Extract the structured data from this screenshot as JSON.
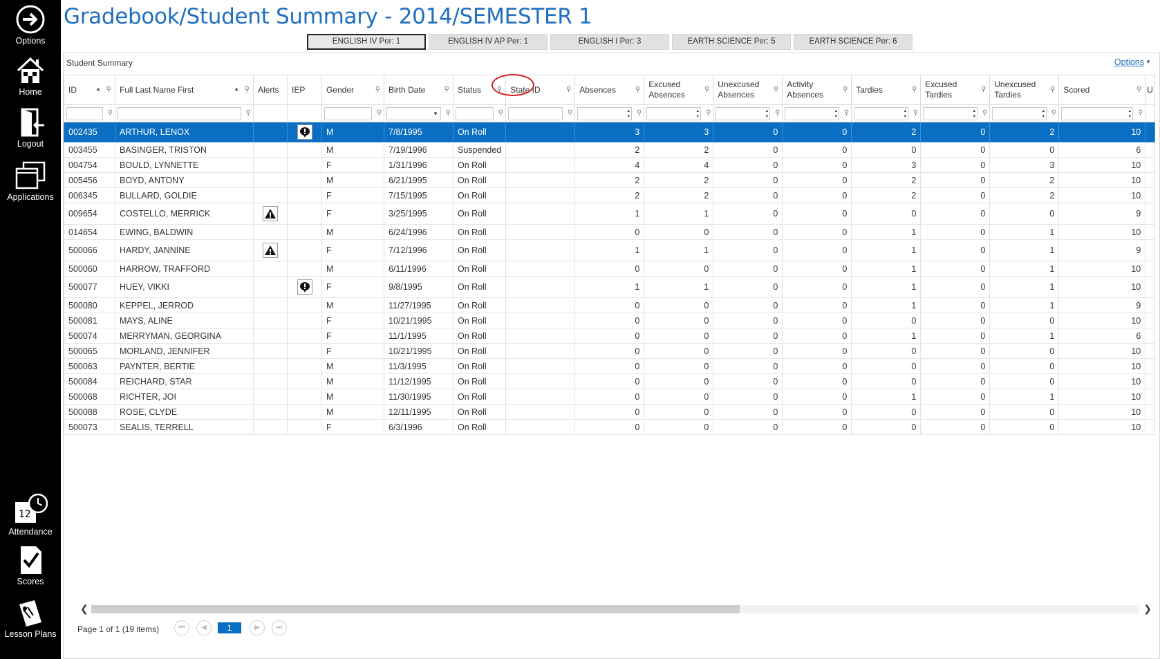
{
  "sidebar": {
    "options": "Options",
    "home": "Home",
    "logout": "Logout",
    "applications": "Applications",
    "attendance": "Attendance",
    "scores": "Scores",
    "lesson_plans": "Lesson Plans"
  },
  "header": {
    "title": "Gradebook/Student Summary - 2014/SEMESTER 1"
  },
  "tabs": [
    {
      "label": "ENGLISH IV Per: 1",
      "active": true
    },
    {
      "label": "ENGLISH IV AP Per: 1",
      "active": false
    },
    {
      "label": "ENGLISH I Per: 3",
      "active": false
    },
    {
      "label": "EARTH SCIENCE Per: 5",
      "active": false
    },
    {
      "label": "EARTH SCIENCE Per: 6",
      "active": false
    }
  ],
  "panel": {
    "title": "Student Summary",
    "options_label": "Options"
  },
  "columns": {
    "id": "ID",
    "name": "Full Last Name First",
    "alerts": "Alerts",
    "iep": "IEP",
    "gender": "Gender",
    "birth": "Birth Date",
    "status": "Status",
    "state_id": "State ID",
    "absences": "Absences",
    "exc_abs_1": "Excused",
    "exc_abs_2": "Absences",
    "unexc_abs_1": "Unexcused",
    "unexc_abs_2": "Absences",
    "act_abs_1": "Activity",
    "act_abs_2": "Absences",
    "tardies": "Tardies",
    "exc_tard_1": "Excused",
    "exc_tard_2": "Tardies",
    "unexc_tard_1": "Unexcused",
    "unexc_tard_2": "Tardies",
    "scored": "Scored",
    "next_partial": "U"
  },
  "rows": [
    {
      "id": "002435",
      "name": "ARTHUR, LENOX",
      "alert": false,
      "iep": true,
      "gender": "M",
      "birth": "7/8/1995",
      "status": "On Roll",
      "state_id": "",
      "absences": "3",
      "exc_abs": "3",
      "unexc_abs": "0",
      "act_abs": "0",
      "tardies": "2",
      "exc_tard": "0",
      "unexc_tard": "2",
      "scored": "10"
    },
    {
      "id": "003455",
      "name": "BASINGER, TRISTON",
      "alert": false,
      "iep": false,
      "gender": "M",
      "birth": "7/19/1996",
      "status": "Suspended",
      "state_id": "",
      "absences": "2",
      "exc_abs": "2",
      "unexc_abs": "0",
      "act_abs": "0",
      "tardies": "0",
      "exc_tard": "0",
      "unexc_tard": "0",
      "scored": "6"
    },
    {
      "id": "004754",
      "name": "BOULD, LYNNETTE",
      "alert": false,
      "iep": false,
      "gender": "F",
      "birth": "1/31/1996",
      "status": "On Roll",
      "state_id": "",
      "absences": "4",
      "exc_abs": "4",
      "unexc_abs": "0",
      "act_abs": "0",
      "tardies": "3",
      "exc_tard": "0",
      "unexc_tard": "3",
      "scored": "10"
    },
    {
      "id": "005456",
      "name": "BOYD, ANTONY",
      "alert": false,
      "iep": false,
      "gender": "M",
      "birth": "6/21/1995",
      "status": "On Roll",
      "state_id": "",
      "absences": "2",
      "exc_abs": "2",
      "unexc_abs": "0",
      "act_abs": "0",
      "tardies": "2",
      "exc_tard": "0",
      "unexc_tard": "2",
      "scored": "10"
    },
    {
      "id": "006345",
      "name": "BULLARD, GOLDIE",
      "alert": false,
      "iep": false,
      "gender": "F",
      "birth": "7/15/1995",
      "status": "On Roll",
      "state_id": "",
      "absences": "2",
      "exc_abs": "2",
      "unexc_abs": "0",
      "act_abs": "0",
      "tardies": "2",
      "exc_tard": "0",
      "unexc_tard": "2",
      "scored": "10"
    },
    {
      "id": "009654",
      "name": "COSTELLO, MERRICK",
      "alert": true,
      "iep": false,
      "gender": "F",
      "birth": "3/25/1995",
      "status": "On Roll",
      "state_id": "",
      "absences": "1",
      "exc_abs": "1",
      "unexc_abs": "0",
      "act_abs": "0",
      "tardies": "0",
      "exc_tard": "0",
      "unexc_tard": "0",
      "scored": "9"
    },
    {
      "id": "014654",
      "name": "EWING, BALDWIN",
      "alert": false,
      "iep": false,
      "gender": "M",
      "birth": "6/24/1996",
      "status": "On Roll",
      "state_id": "",
      "absences": "0",
      "exc_abs": "0",
      "unexc_abs": "0",
      "act_abs": "0",
      "tardies": "1",
      "exc_tard": "0",
      "unexc_tard": "1",
      "scored": "10"
    },
    {
      "id": "500066",
      "name": "HARDY, JANNINE",
      "alert": true,
      "iep": false,
      "gender": "F",
      "birth": "7/12/1996",
      "status": "On Roll",
      "state_id": "",
      "absences": "1",
      "exc_abs": "1",
      "unexc_abs": "0",
      "act_abs": "0",
      "tardies": "1",
      "exc_tard": "0",
      "unexc_tard": "1",
      "scored": "9"
    },
    {
      "id": "500060",
      "name": "HARROW, TRAFFORD",
      "alert": false,
      "iep": false,
      "gender": "M",
      "birth": "6/11/1996",
      "status": "On Roll",
      "state_id": "",
      "absences": "0",
      "exc_abs": "0",
      "unexc_abs": "0",
      "act_abs": "0",
      "tardies": "1",
      "exc_tard": "0",
      "unexc_tard": "1",
      "scored": "10"
    },
    {
      "id": "500077",
      "name": "HUEY, VIKKI",
      "alert": false,
      "iep": true,
      "gender": "F",
      "birth": "9/8/1995",
      "status": "On Roll",
      "state_id": "",
      "absences": "1",
      "exc_abs": "1",
      "unexc_abs": "0",
      "act_abs": "0",
      "tardies": "1",
      "exc_tard": "0",
      "unexc_tard": "1",
      "scored": "10"
    },
    {
      "id": "500080",
      "name": "KEPPEL, JERROD",
      "alert": false,
      "iep": false,
      "gender": "M",
      "birth": "11/27/1995",
      "status": "On Roll",
      "state_id": "",
      "absences": "0",
      "exc_abs": "0",
      "unexc_abs": "0",
      "act_abs": "0",
      "tardies": "1",
      "exc_tard": "0",
      "unexc_tard": "1",
      "scored": "9"
    },
    {
      "id": "500081",
      "name": "MAYS, ALINE",
      "alert": false,
      "iep": false,
      "gender": "F",
      "birth": "10/21/1995",
      "status": "On Roll",
      "state_id": "",
      "absences": "0",
      "exc_abs": "0",
      "unexc_abs": "0",
      "act_abs": "0",
      "tardies": "0",
      "exc_tard": "0",
      "unexc_tard": "0",
      "scored": "10"
    },
    {
      "id": "500074",
      "name": "MERRYMAN, GEORGINA",
      "alert": false,
      "iep": false,
      "gender": "F",
      "birth": "11/1/1995",
      "status": "On Roll",
      "state_id": "",
      "absences": "0",
      "exc_abs": "0",
      "unexc_abs": "0",
      "act_abs": "0",
      "tardies": "1",
      "exc_tard": "0",
      "unexc_tard": "1",
      "scored": "6"
    },
    {
      "id": "500065",
      "name": "MORLAND, JENNIFER",
      "alert": false,
      "iep": false,
      "gender": "F",
      "birth": "10/21/1995",
      "status": "On Roll",
      "state_id": "",
      "absences": "0",
      "exc_abs": "0",
      "unexc_abs": "0",
      "act_abs": "0",
      "tardies": "0",
      "exc_tard": "0",
      "unexc_tard": "0",
      "scored": "10"
    },
    {
      "id": "500063",
      "name": "PAYNTER, BERTIE",
      "alert": false,
      "iep": false,
      "gender": "M",
      "birth": "11/3/1995",
      "status": "On Roll",
      "state_id": "",
      "absences": "0",
      "exc_abs": "0",
      "unexc_abs": "0",
      "act_abs": "0",
      "tardies": "0",
      "exc_tard": "0",
      "unexc_tard": "0",
      "scored": "10"
    },
    {
      "id": "500084",
      "name": "REICHARD, STAR",
      "alert": false,
      "iep": false,
      "gender": "M",
      "birth": "11/12/1995",
      "status": "On Roll",
      "state_id": "",
      "absences": "0",
      "exc_abs": "0",
      "unexc_abs": "0",
      "act_abs": "0",
      "tardies": "0",
      "exc_tard": "0",
      "unexc_tard": "0",
      "scored": "10"
    },
    {
      "id": "500068",
      "name": "RICHTER, JOI",
      "alert": false,
      "iep": false,
      "gender": "M",
      "birth": "11/30/1995",
      "status": "On Roll",
      "state_id": "",
      "absences": "0",
      "exc_abs": "0",
      "unexc_abs": "0",
      "act_abs": "0",
      "tardies": "1",
      "exc_tard": "0",
      "unexc_tard": "1",
      "scored": "10"
    },
    {
      "id": "500088",
      "name": "ROSE, CLYDE",
      "alert": false,
      "iep": false,
      "gender": "M",
      "birth": "12/11/1995",
      "status": "On Roll",
      "state_id": "",
      "absences": "0",
      "exc_abs": "0",
      "unexc_abs": "0",
      "act_abs": "0",
      "tardies": "0",
      "exc_tard": "0",
      "unexc_tard": "0",
      "scored": "10"
    },
    {
      "id": "500073",
      "name": "SEALIS, TERRELL",
      "alert": false,
      "iep": false,
      "gender": "F",
      "birth": "6/3/1996",
      "status": "On Roll",
      "state_id": "",
      "absences": "0",
      "exc_abs": "0",
      "unexc_abs": "0",
      "act_abs": "0",
      "tardies": "0",
      "exc_tard": "0",
      "unexc_tard": "0",
      "scored": "10"
    }
  ],
  "selected_row": 0,
  "pager": {
    "text": "Page 1 of 1 (19 items)",
    "current_page": "1"
  },
  "colors": {
    "accent": "#1f6fbf",
    "selected_row": "#0a6fc2",
    "sidebar": "#000000",
    "annotation": "#d21f1f"
  }
}
